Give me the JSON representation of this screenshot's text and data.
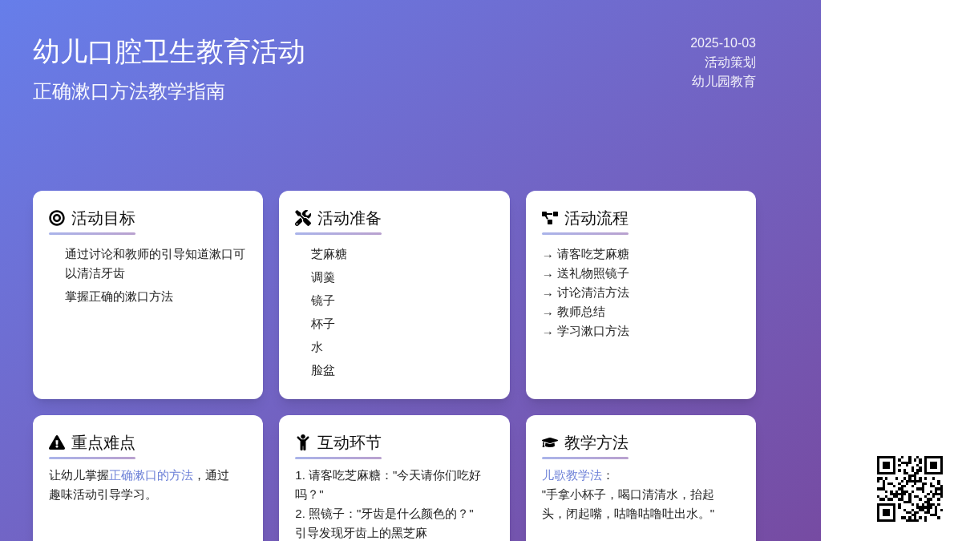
{
  "header": {
    "title": "幼儿口腔卫生教育活动",
    "subtitle": "正确漱口方法教学指南",
    "meta": [
      "2025-10-03",
      "活动策划",
      "幼儿园教育"
    ]
  },
  "cards": [
    {
      "title": "活动目标",
      "kind": "list",
      "items": [
        "通过讨论和教师的引导知道漱口可以清洁牙齿",
        "掌握正确的漱口方法"
      ]
    },
    {
      "title": "活动准备",
      "kind": "list",
      "items": [
        "芝麻糖",
        "调羹",
        "镜子",
        "杯子",
        "水",
        "脸盆"
      ]
    },
    {
      "title": "活动流程",
      "kind": "steps",
      "items": [
        "→ 请客吃芝麻糖",
        "→ 送礼物照镜子",
        "→ 讨论清洁方法",
        "→ 教师总结",
        "→ 学习漱口方法"
      ]
    },
    {
      "title": "重点难点",
      "kind": "text",
      "paragraphs": [
        [
          {
            "text": "让幼儿掌握",
            "highlight": false
          },
          {
            "text": "正确漱口的方法",
            "highlight": true
          },
          {
            "text": "，通过趣味活动引导学习。",
            "highlight": false
          }
        ]
      ]
    },
    {
      "title": "互动环节",
      "kind": "text",
      "paragraphs": [
        [
          {
            "text": "1. 请客吃芝麻糖：\"今天请你们吃好吗？\"",
            "highlight": false
          }
        ],
        [
          {
            "text": "2. 照镜子：\"牙齿是什么颜色的？\"",
            "highlight": false
          }
        ],
        [
          {
            "text": "引导发现牙齿上的黑芝麻",
            "highlight": false
          }
        ]
      ]
    },
    {
      "title": "教学方法",
      "kind": "text",
      "paragraphs": [
        [
          {
            "text": "儿歌教学法",
            "highlight": true
          },
          {
            "text": "：",
            "highlight": false
          }
        ],
        [
          {
            "text": "\"手拿小杯子，喝口清清水，抬起头，闭起嘴，咕噜咕噜吐出水。\"",
            "highlight": false
          }
        ]
      ]
    }
  ]
}
